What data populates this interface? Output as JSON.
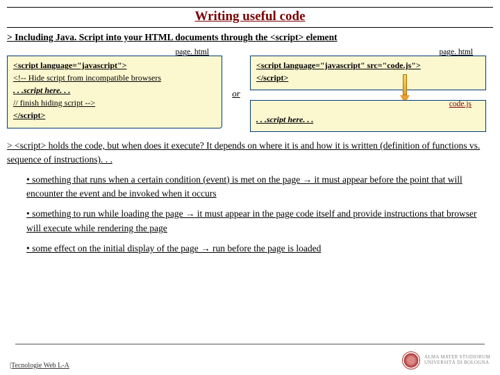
{
  "title": "Writing useful code",
  "intro_prefix": "> ",
  "intro": "Including Java. Script into your HTML documents through the <script> element",
  "left": {
    "label": "page. html",
    "l1": "<script language=\"javascript\">",
    "l2": "<!-- Hide script from incompatible browsers",
    "l3": ". . .script here. . .",
    "l4": "// finish hiding script -->",
    "l5": "</script>"
  },
  "or": "or",
  "right1": {
    "label": "page. html",
    "l1": "<script language=\"javascript\" src=\"code.js\">",
    "l2": "</script>"
  },
  "right2": {
    "label": "code.js",
    "l1": ". . .script here. . ."
  },
  "para_prefix": "> ",
  "para": "<script> holds the code, but when does it execute? It depends on where it is and how it is written (definition of functions vs. sequence of instructions). . .",
  "b1": "• something that runs when a certain condition (event) is met on the page → it must appear before the point that will encounter the event and be invoked when it occurs ",
  "b2": "• something to run while loading the page → it must appear in the page code itself and provide instructions that browser will execute while rendering the page",
  "b3": "• some effect on the initial display of the page → run before the page is loaded",
  "footer_text": "|Tecnologie Web L-A",
  "uni1": "ALMA MATER STUDIORUM",
  "uni2": "UNIVERSITÀ DI BOLOGNA"
}
